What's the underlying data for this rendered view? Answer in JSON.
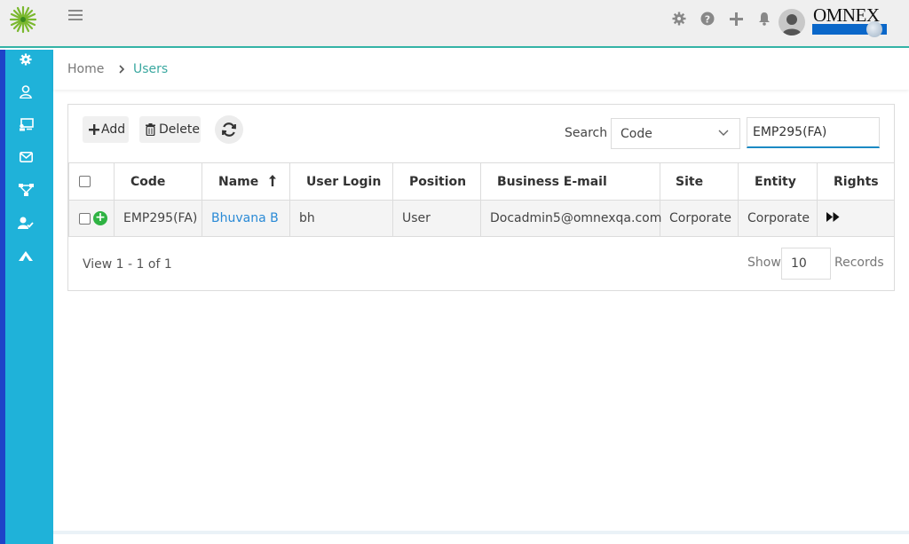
{
  "app": {
    "brand": "OMNEX",
    "colors": {
      "sidebar": "#1fb2d9",
      "sidebar_edge": "#1e43c8",
      "accent": "#34b3a6",
      "link": "#2a8ad6",
      "brand_blue": "#0a67c9"
    }
  },
  "header": {
    "icons": [
      "gear-icon",
      "help-icon",
      "plus-icon",
      "bell-icon"
    ]
  },
  "sidebar": {
    "items": [
      {
        "icon": "settings-icon"
      },
      {
        "icon": "user-icon"
      },
      {
        "icon": "presentation-icon"
      },
      {
        "icon": "mail-icon"
      },
      {
        "icon": "hierarchy-icon"
      },
      {
        "icon": "user-check-icon"
      },
      {
        "icon": "mountain-icon"
      }
    ]
  },
  "breadcrumb": {
    "home": "Home",
    "current": "Users"
  },
  "toolbar": {
    "add_label": "Add",
    "delete_label": "Delete",
    "search_label": "Search",
    "search_field": "Code",
    "search_value": "EMP295(FA)"
  },
  "table": {
    "columns": [
      "Code",
      "Name",
      "User Login",
      "Position",
      "Business E-mail",
      "Site",
      "Entity",
      "Rights"
    ],
    "rows": [
      {
        "code": "EMP295(FA)",
        "name": "Bhuvana B",
        "login": "bh",
        "position": "User",
        "email": "Docadmin5@omnexqa.com",
        "site": "Corporate",
        "entity": "Corporate"
      }
    ]
  },
  "pager": {
    "info": "View 1 - 1 of 1",
    "show_label": "Show",
    "page_size": "10",
    "records_label": "Records"
  }
}
